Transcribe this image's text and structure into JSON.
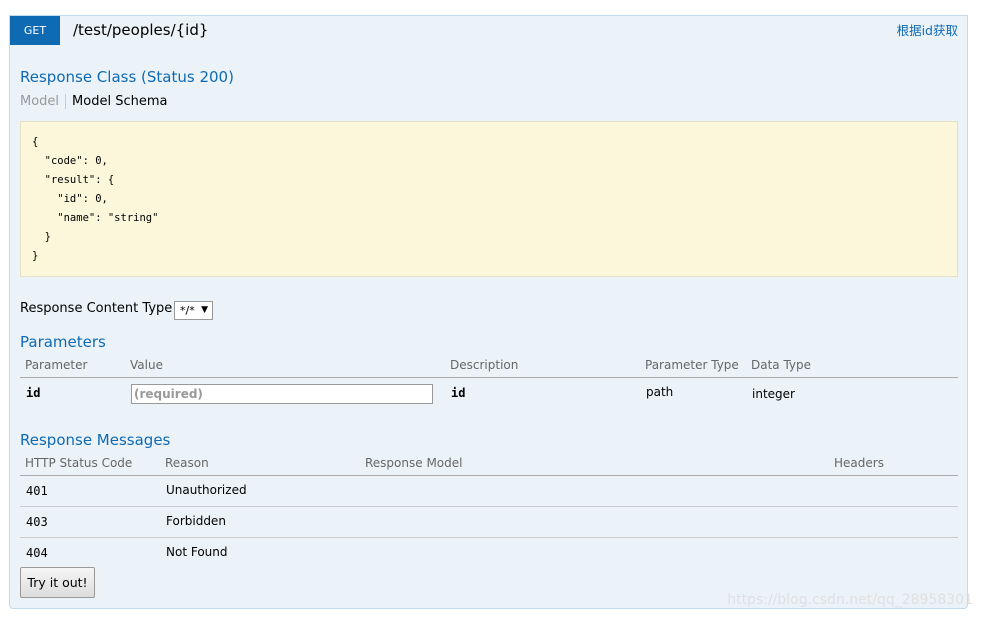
{
  "endpoint": {
    "method": "GET",
    "path": "/test/peoples/{id}",
    "summary": "根据id获取"
  },
  "response_class": {
    "title": "Response Class (Status 200)",
    "tabs": [
      "Model",
      "Model Schema"
    ],
    "schema_lines": [
      "{",
      "  \"code\": 0,",
      "  \"result\": {",
      "    \"id\": 0,",
      "    \"name\": \"string\"",
      "  }",
      "}"
    ]
  },
  "content_type": {
    "label": "Response Content Type",
    "selected": "*/*"
  },
  "parameters": {
    "title": "Parameters",
    "headers": [
      "Parameter",
      "Value",
      "Description",
      "Parameter Type",
      "Data Type"
    ],
    "rows": [
      {
        "name": "id",
        "placeholder": "(required)",
        "description": "id",
        "param_type": "path",
        "data_type": "integer"
      }
    ]
  },
  "response_messages": {
    "title": "Response Messages",
    "headers": [
      "HTTP Status Code",
      "Reason",
      "Response Model",
      "Headers"
    ],
    "rows": [
      {
        "code": "401",
        "reason": "Unauthorized"
      },
      {
        "code": "403",
        "reason": "Forbidden"
      },
      {
        "code": "404",
        "reason": "Not Found"
      }
    ]
  },
  "try_button": "Try it out!",
  "watermark": "https://blog.csdn.net/qq_28958301",
  "colors": {
    "accent": "#0f6ab4",
    "panel_bg": "#ebf3f9",
    "schema_bg": "#fcf6db"
  }
}
